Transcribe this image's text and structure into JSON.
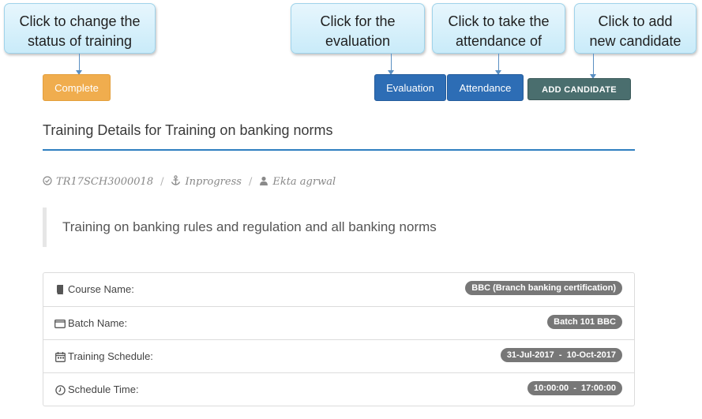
{
  "callouts": {
    "status": [
      "Click to change the",
      "status of training"
    ],
    "evaluation": [
      "Click for the",
      "evaluation"
    ],
    "attendance": [
      "Click to take the",
      "attendance of"
    ],
    "add": [
      "Click to add",
      "new candidate"
    ]
  },
  "buttons": {
    "complete": "Complete",
    "evaluation": "Evaluation",
    "attendance": "Attendance",
    "add_candidate": "ADD CANDIDATE"
  },
  "title": "Training Details for Training on banking norms",
  "meta": {
    "code": "TR17SCH3000018",
    "status": "Inprogress",
    "user": "Ekta agrwal"
  },
  "description": "Training on banking rules and regulation and all banking norms",
  "details": [
    {
      "label": "Course Name:",
      "value": "BBC (Branch banking certification)",
      "icon": "book-icon"
    },
    {
      "label": "Batch Name:",
      "value": "Batch 101 BBC",
      "icon": "window-icon"
    },
    {
      "label": "Training Schedule:",
      "value": "31-Jul-2017  -  10-Oct-2017",
      "icon": "calendar-icon"
    },
    {
      "label": "Schedule Time:",
      "value": "10:00:00  -  17:00:00",
      "icon": "clock-icon"
    }
  ],
  "colors": {
    "complete": "#f0ad4e",
    "primary": "#2d6db5",
    "add": "#4a6e6e",
    "rule": "#2f7fc0"
  }
}
